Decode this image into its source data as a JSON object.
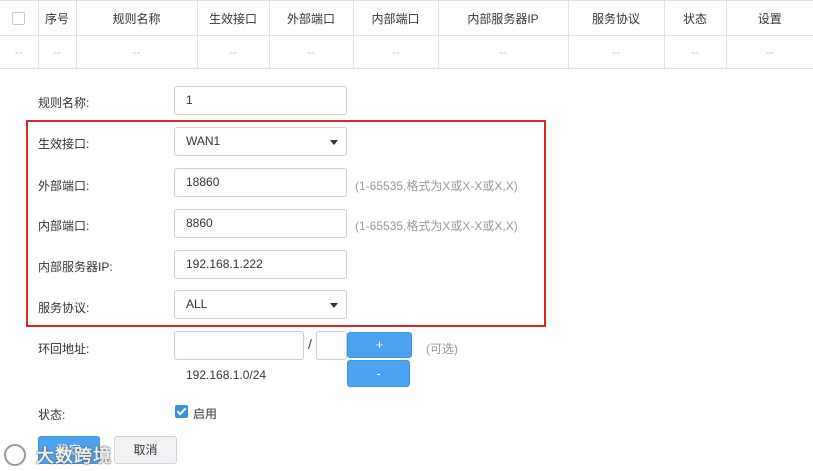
{
  "table": {
    "headers": [
      "",
      "序号",
      "规则名称",
      "生效接口",
      "外部端口",
      "内部端口",
      "内部服务器IP",
      "服务协议",
      "状态",
      "设置"
    ],
    "empty_row": [
      "--",
      "--",
      "--",
      "--",
      "--",
      "--",
      "--",
      "--",
      "--",
      "--"
    ]
  },
  "form": {
    "rule_name": {
      "label": "规则名称:",
      "value": "1"
    },
    "interface": {
      "label": "生效接口:",
      "value": "WAN1"
    },
    "external_port": {
      "label": "外部端口:",
      "value": "18860",
      "hint": "(1-65535,格式为X或X-X或X,X)"
    },
    "internal_port": {
      "label": "内部端口:",
      "value": "8860",
      "hint": "(1-65535,格式为X或X-X或X,X)"
    },
    "internal_ip": {
      "label": "内部服务器IP:",
      "value": "192.168.1.222"
    },
    "protocol": {
      "label": "服务协议:",
      "value": "ALL"
    },
    "loopback": {
      "label": "环回地址:",
      "ip_value": "",
      "mask_value": "",
      "separator": "/",
      "add_label": "+",
      "remove_label": "-",
      "optional": "(可选)",
      "entry": "192.168.1.0/24"
    },
    "status": {
      "label": "状态:",
      "checkbox_label": "启用",
      "checked": true
    },
    "confirm_label": "确定",
    "cancel_label": "取消"
  },
  "watermark": {
    "text": "大数跨境"
  },
  "colors": {
    "highlight": "#d9262c",
    "accent": "#4da3f1"
  }
}
